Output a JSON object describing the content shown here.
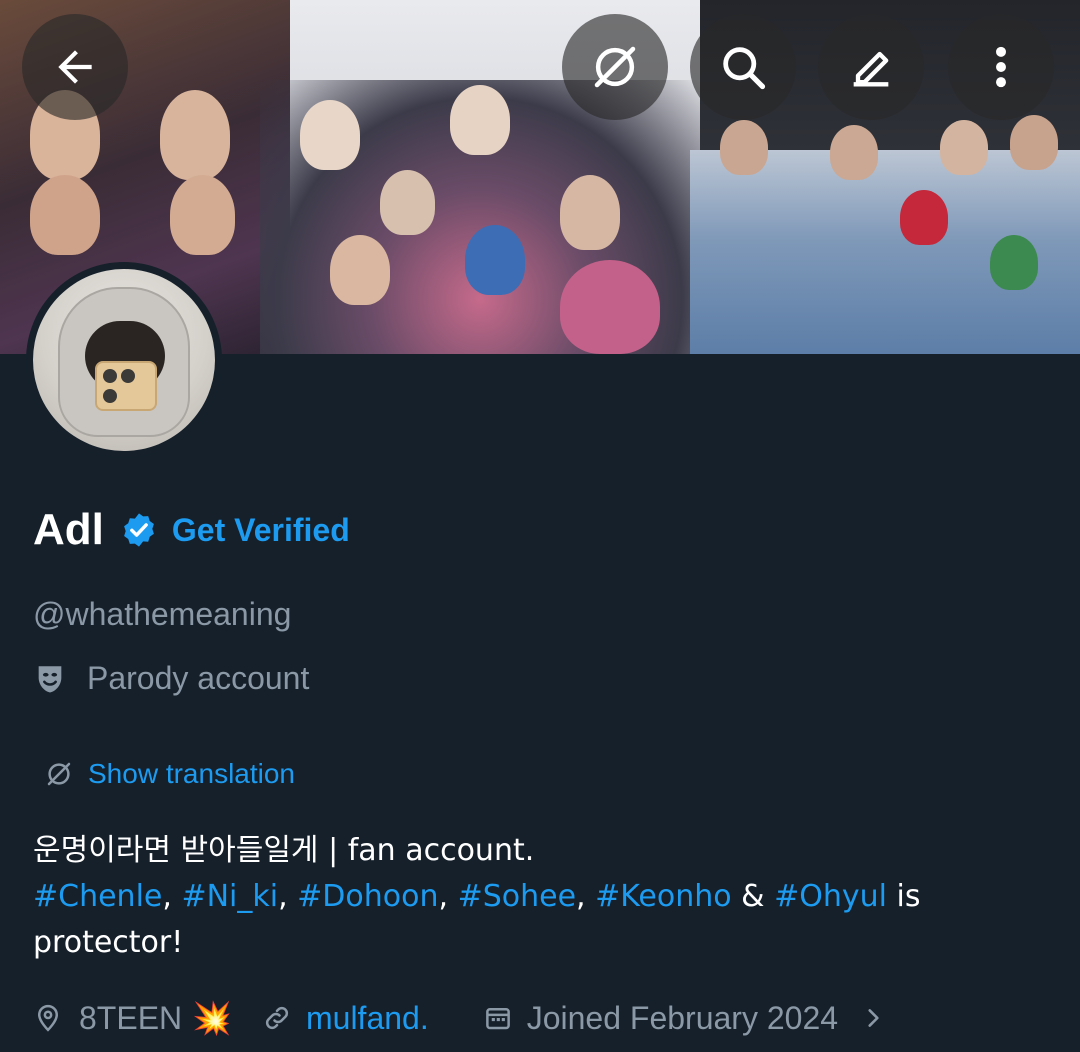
{
  "header": {
    "back_icon": "arrow-left-icon",
    "translate_icon": "translate-globe-icon",
    "search_icon": "search-icon",
    "edit_icon": "pencil-icon",
    "more_icon": "more-vertical-icon"
  },
  "profile": {
    "name": "Adl",
    "verified_icon": "verified-badge-icon",
    "get_verified_label": "Get Verified",
    "handle": "@whathemeaning",
    "parody_label": "Parody account",
    "show_translation_label": "Show translation",
    "bio_line1": "운명이라면 받아들일게 | fan account.",
    "hashtags": [
      "#Chenle",
      "#Ni_ki",
      "#Dohoon",
      "#Sohee",
      "#Keonho",
      "#Ohyul"
    ],
    "bio_sep1": ", ",
    "bio_amp": " & ",
    "bio_tail": " is protector!",
    "location": "8TEEN",
    "location_emoji": "💥",
    "website": "mulfand.",
    "joined": "Joined February 2024"
  },
  "colors": {
    "background": "#15202b",
    "accent": "#1d9bf0",
    "secondary_text": "#8b98a5"
  }
}
